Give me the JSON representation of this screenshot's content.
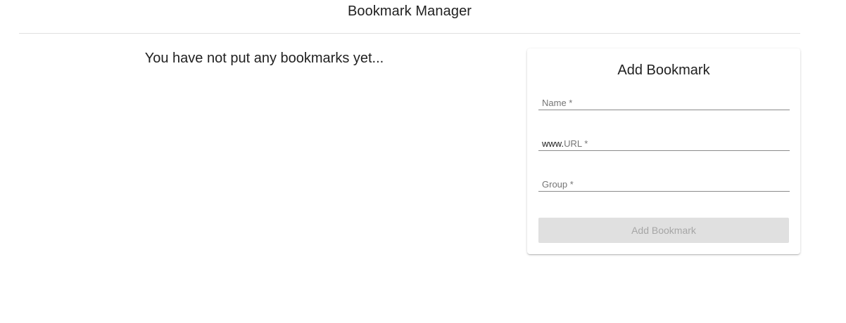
{
  "header": {
    "title": "Bookmark Manager"
  },
  "main": {
    "empty_message": "You have not put any bookmarks yet..."
  },
  "form": {
    "title": "Add Bookmark",
    "fields": {
      "name": {
        "label": "Name *",
        "value": ""
      },
      "url": {
        "prefix": "www.",
        "label": "URL *",
        "value": ""
      },
      "group": {
        "label": "Group *",
        "value": ""
      }
    },
    "submit_label": "Add Bookmark",
    "submit_disabled": true
  },
  "colors": {
    "divider": "#e0e0e0",
    "button_disabled_bg": "#e0e0e0",
    "button_disabled_text": "#a6a6a6",
    "underline": "#8a8a8a"
  }
}
